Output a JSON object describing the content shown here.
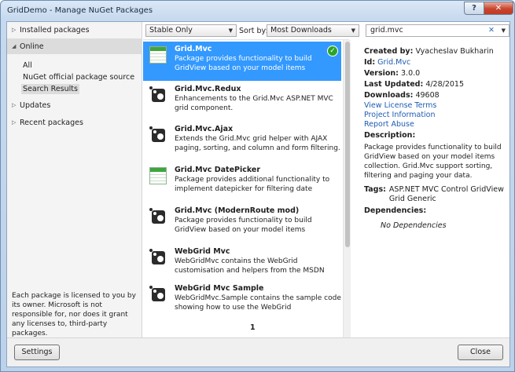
{
  "window": {
    "title": "GridDemo - Manage NuGet Packages",
    "help_label": "?",
    "close_label": "✕"
  },
  "sidebar": {
    "installed": "Installed packages",
    "online": "Online",
    "online_items": [
      "All",
      "NuGet official package source",
      "Search Results"
    ],
    "updates": "Updates",
    "recent": "Recent packages",
    "license_text": "Each package is licensed to you by its owner. Microsoft is not responsible for, nor does it grant any licenses to, third-party packages."
  },
  "filter": {
    "channel": "Stable Only",
    "sort_label": "Sort by:",
    "sort_value": "Most Downloads",
    "search_value": "grid.mvc"
  },
  "packages": [
    {
      "title": "Grid.Mvc",
      "desc": "Package provides functionality to build GridView based on your model items collection. Grid.Mv...",
      "icon": "grid-icon",
      "installed": true
    },
    {
      "title": "Grid.Mvc.Redux",
      "desc": "Enhancements to the Grid.Mvc ASP.NET MVC grid component.",
      "icon": "nuget-icon",
      "installed": false
    },
    {
      "title": "Grid.Mvc.Ajax",
      "desc": "Extends the Grid.Mvc grid helper with AJAX paging, sorting, and column and form filtering.",
      "icon": "nuget-icon",
      "installed": false
    },
    {
      "title": "Grid.Mvc DatePicker",
      "desc": "Package provides additional functionality to implement datepicker for filtering date columns in...",
      "icon": "grid-icon",
      "installed": false
    },
    {
      "title": "Grid.Mvc (ModernRoute mod)",
      "desc": "Package provides functionality to build GridView based on your model items collection. Grid.Mvc s...",
      "icon": "nuget-icon",
      "installed": false
    },
    {
      "title": "WebGrid Mvc",
      "desc": "WebGridMvc contains the WebGrid customisation and helpers from the MSDN magazine article \"Get...",
      "icon": "nuget-icon",
      "installed": false
    },
    {
      "title": "WebGrid Mvc Sample",
      "desc": "WebGridMvc.Sample contains the sample code showing how to use the WebGrid customisation a...",
      "icon": "nuget-icon",
      "installed": false
    }
  ],
  "pager": {
    "page": "1"
  },
  "details": {
    "created_by_label": "Created by:",
    "created_by": "Vyacheslav Bukharin",
    "id_label": "Id:",
    "id": "Grid.Mvc",
    "version_label": "Version:",
    "version": "3.0.0",
    "updated_label": "Last Updated:",
    "updated": "4/28/2015",
    "downloads_label": "Downloads:",
    "downloads": "49608",
    "license_link": "View License Terms",
    "project_link": "Project Information",
    "abuse_link": "Report Abuse",
    "description_label": "Description:",
    "description": "Package provides functionality to build GridView based on your model items collection. Grid.Mvc support sorting, filtering and paging your data.",
    "tags_label": "Tags:",
    "tags": "ASP.NET MVC Control GridView Grid Generic",
    "deps_label": "Dependencies:",
    "deps": "No Dependencies"
  },
  "buttons": {
    "settings": "Settings",
    "close": "Close"
  }
}
